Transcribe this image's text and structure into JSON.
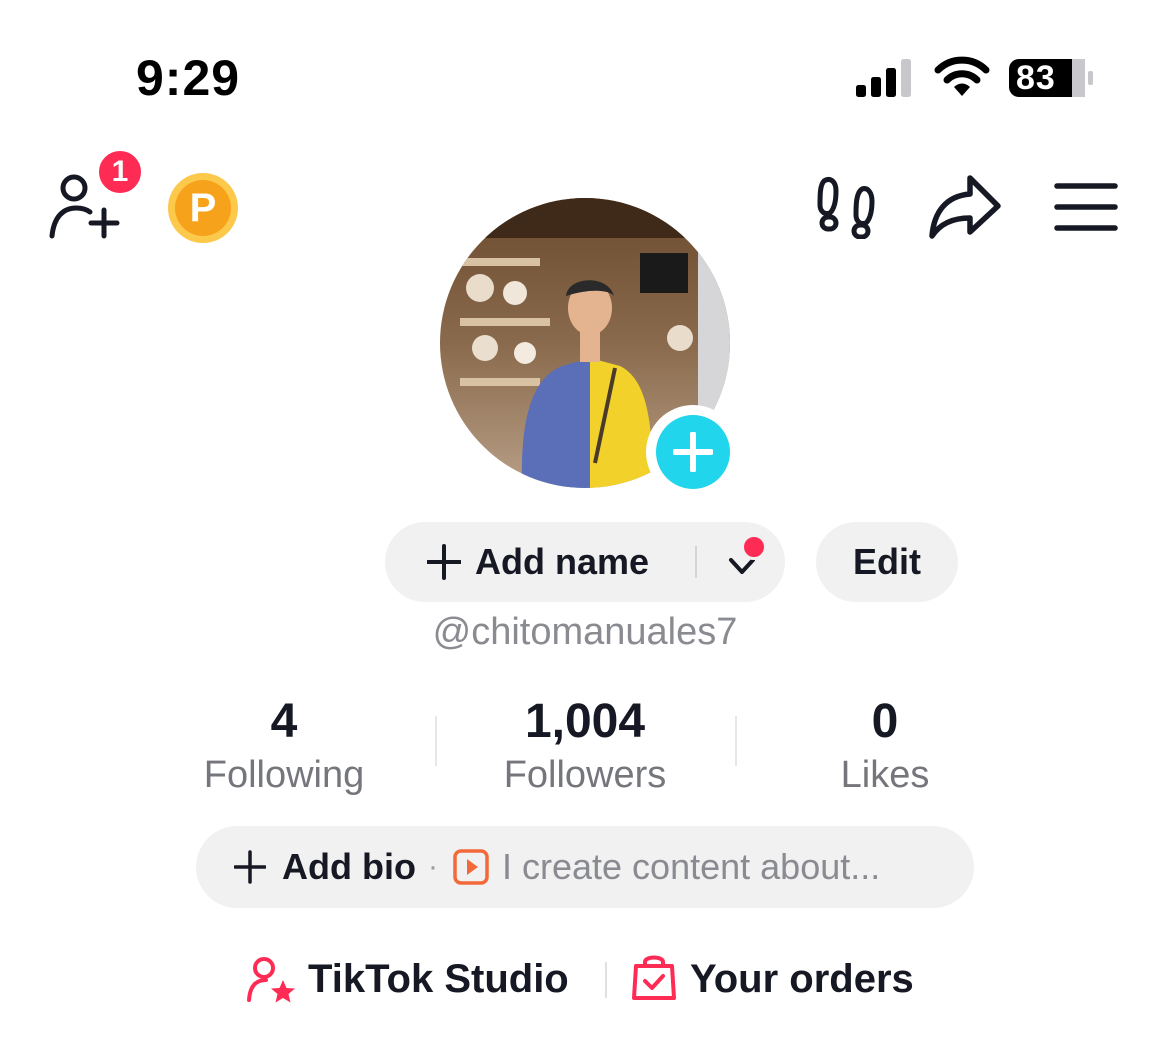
{
  "status_bar": {
    "time": "9:29",
    "battery_level": "83",
    "signal_bars": 3,
    "signal_bars_total": 4
  },
  "top_nav": {
    "add_friend_icon": "person-add-icon",
    "notification_count": "1",
    "points_icon": "points-coin-icon",
    "points_letter": "P",
    "footprint_icon": "footprint-icon",
    "share_icon": "share-arrow-icon",
    "menu_icon": "hamburger-menu-icon"
  },
  "profile": {
    "avatar_add_icon": "plus-icon",
    "add_name_label": "Add name",
    "edit_label": "Edit",
    "username": "@chitomanuales7"
  },
  "stats": [
    {
      "value": "4",
      "label": "Following"
    },
    {
      "value": "1,004",
      "label": "Followers"
    },
    {
      "value": "0",
      "label": "Likes"
    }
  ],
  "bio": {
    "add_label": "Add bio",
    "separator": "·",
    "hint": "I create content about..."
  },
  "links": {
    "studio_label": "TikTok Studio",
    "orders_label": "Your orders"
  },
  "colors": {
    "accent_red": "#fe2c55",
    "avatar_add_blue": "#20d5ec",
    "points_orange": "#f7a21b",
    "pill_bg": "#f1f1f2",
    "muted_text": "#8a8b91"
  }
}
